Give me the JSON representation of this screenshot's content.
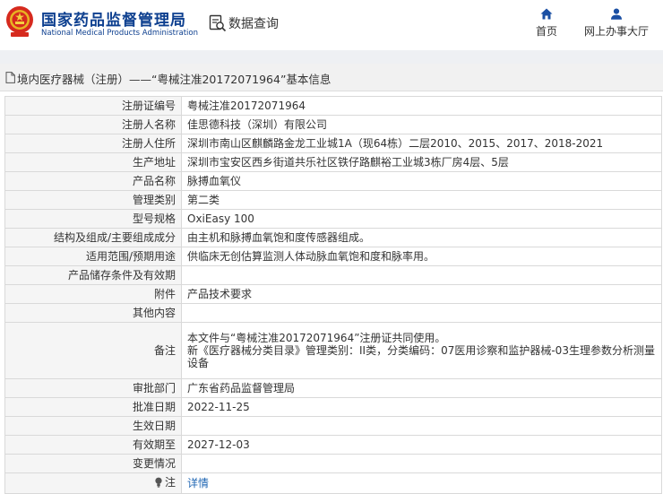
{
  "header": {
    "brand_cn": "国家药品监督管理局",
    "brand_en": "National Medical Products Administration",
    "query_label": "数据查询",
    "nav": [
      {
        "label": "首页",
        "icon": "home-icon"
      },
      {
        "label": "网上办事大厅",
        "icon": "user-icon"
      }
    ]
  },
  "title": "境内医疗器械（注册）——“粤械注准20172071964”基本信息",
  "rows": [
    {
      "label": "注册证编号",
      "value": "粤械注准20172071964"
    },
    {
      "label": "注册人名称",
      "value": "佳思德科技（深圳）有限公司"
    },
    {
      "label": "注册人住所",
      "value": "深圳市南山区麒麟路金龙工业城1A（现64栋）二层2010、2015、2017、2018-2021"
    },
    {
      "label": "生产地址",
      "value": "深圳市宝安区西乡街道共乐社区铁仔路麒裕工业城3栋厂房4层、5层"
    },
    {
      "label": "产品名称",
      "value": "脉搏血氧仪"
    },
    {
      "label": "管理类别",
      "value": "第二类"
    },
    {
      "label": "型号规格",
      "value": "OxiEasy 100"
    },
    {
      "label": "结构及组成/主要组成成分",
      "value": "由主机和脉搏血氧饱和度传感器组成。"
    },
    {
      "label": "适用范围/预期用途",
      "value": "供临床无创估算监测人体动脉血氧饱和度和脉率用。"
    },
    {
      "label": "产品储存条件及有效期",
      "value": ""
    },
    {
      "label": "附件",
      "value": "产品技术要求"
    },
    {
      "label": "其他内容",
      "value": ""
    },
    {
      "label": "备注",
      "value": "本文件与“粤械注准20172071964”注册证共同使用。\n新《医疗器械分类目录》管理类别：II类，分类编码：07医用诊察和监护器械-03生理参数分析测量设备"
    },
    {
      "label": "审批部门",
      "value": "广东省药品监督管理局"
    },
    {
      "label": "批准日期",
      "value": "2022-11-25"
    },
    {
      "label": "生效日期",
      "value": ""
    },
    {
      "label": "有效期至",
      "value": "2027-12-03"
    },
    {
      "label": "变更情况",
      "value": ""
    }
  ],
  "note": {
    "label": "注",
    "link": "详情"
  },
  "colors": {
    "brand": "#0d3f8f",
    "link": "#1f66b3",
    "label_bg": "#f5f5f5",
    "border": "#d9d9d9"
  }
}
